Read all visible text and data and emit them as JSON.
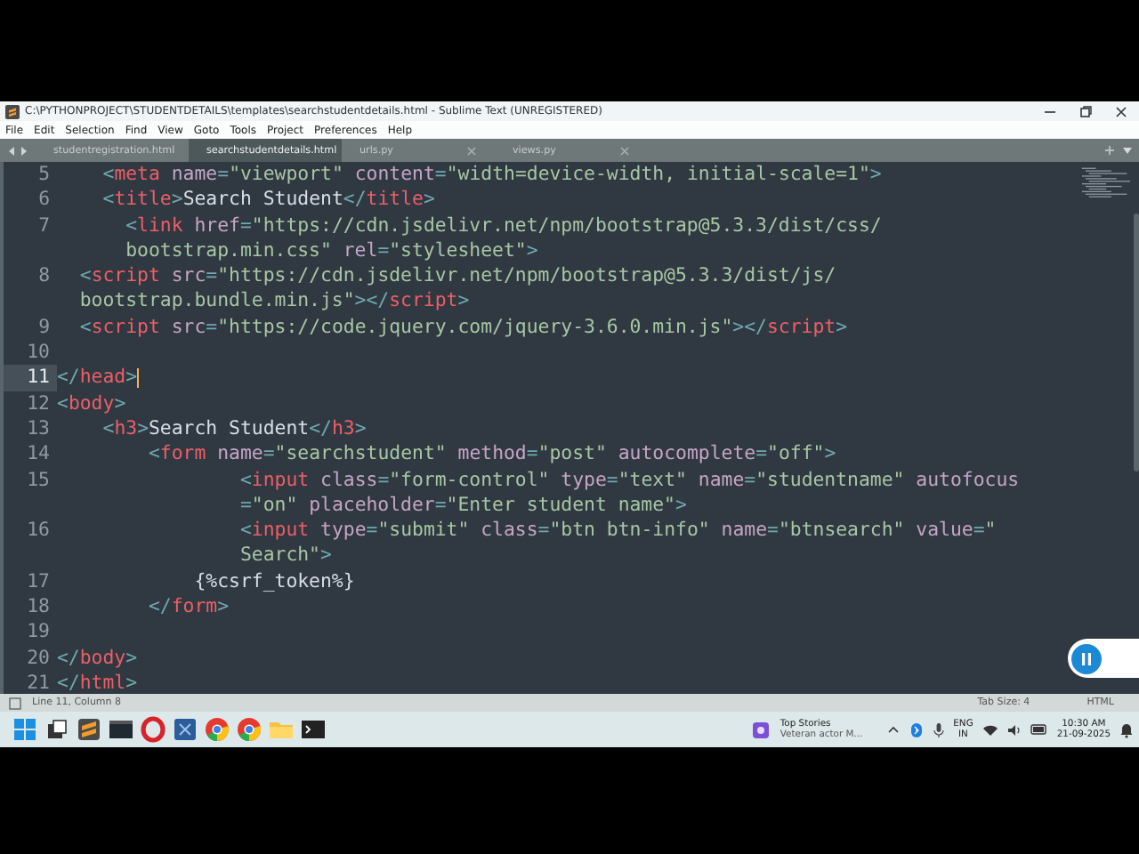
{
  "window": {
    "title": "C:\\PYTHONPROJECT\\STUDENTDETAILS\\templates\\searchstudentdetails.html - Sublime Text (UNREGISTERED)"
  },
  "menu": [
    "File",
    "Edit",
    "Selection",
    "Find",
    "View",
    "Goto",
    "Tools",
    "Project",
    "Preferences",
    "Help"
  ],
  "tabs": [
    {
      "label": "studentregistration.html",
      "selected": false
    },
    {
      "label": "searchstudentdetails.html",
      "selected": true
    },
    {
      "label": "urls.py",
      "selected": false
    },
    {
      "label": "views.py",
      "selected": false
    }
  ],
  "editor": {
    "lines": [
      {
        "number": "5",
        "current": false,
        "rows": [
          {
            "segments": [
              {
                "kind": "punct",
                "text": "    <"
              },
              {
                "kind": "tag",
                "text": "meta"
              },
              {
                "kind": "attr",
                "text": " name"
              },
              {
                "kind": "punct",
                "text": "="
              },
              {
                "kind": "string",
                "text": "\"viewport\""
              },
              {
                "kind": "attr",
                "text": " content"
              },
              {
                "kind": "punct",
                "text": "="
              },
              {
                "kind": "string",
                "text": "\"width=device-width, initial-scale=1\""
              },
              {
                "kind": "punct",
                "text": ">"
              }
            ]
          }
        ]
      },
      {
        "number": "6",
        "current": false,
        "rows": [
          {
            "segments": [
              {
                "kind": "punct",
                "text": "    <"
              },
              {
                "kind": "tag",
                "text": "title"
              },
              {
                "kind": "punct",
                "text": ">"
              },
              {
                "kind": "text",
                "text": "Search Student"
              },
              {
                "kind": "punct",
                "text": "</"
              },
              {
                "kind": "tag",
                "text": "title"
              },
              {
                "kind": "punct",
                "text": ">"
              }
            ]
          }
        ]
      },
      {
        "number": "7",
        "current": false,
        "rows": [
          {
            "segments": [
              {
                "kind": "punct",
                "text": "      <"
              },
              {
                "kind": "tag",
                "text": "link"
              },
              {
                "kind": "attr",
                "text": " href"
              },
              {
                "kind": "punct",
                "text": "="
              },
              {
                "kind": "string",
                "text": "\"https://cdn.jsdelivr.net/npm/bootstrap@5.3.3/dist/css/"
              }
            ]
          },
          {
            "segments": [
              {
                "kind": "string",
                "text": "      bootstrap.min.css\""
              },
              {
                "kind": "attr",
                "text": " rel"
              },
              {
                "kind": "punct",
                "text": "="
              },
              {
                "kind": "string",
                "text": "\"stylesheet\""
              },
              {
                "kind": "punct",
                "text": ">"
              }
            ]
          }
        ]
      },
      {
        "number": "8",
        "current": false,
        "rows": [
          {
            "segments": [
              {
                "kind": "punct",
                "text": "  <"
              },
              {
                "kind": "tag",
                "text": "script"
              },
              {
                "kind": "attr",
                "text": " src"
              },
              {
                "kind": "punct",
                "text": "="
              },
              {
                "kind": "string",
                "text": "\"https://cdn.jsdelivr.net/npm/bootstrap@5.3.3/dist/js/"
              }
            ]
          },
          {
            "segments": [
              {
                "kind": "string",
                "text": "  bootstrap.bundle.min.js\""
              },
              {
                "kind": "punct",
                "text": "></"
              },
              {
                "kind": "tag",
                "text": "script"
              },
              {
                "kind": "punct",
                "text": ">"
              }
            ]
          }
        ]
      },
      {
        "number": "9",
        "current": false,
        "rows": [
          {
            "segments": [
              {
                "kind": "punct",
                "text": "  <"
              },
              {
                "kind": "tag",
                "text": "script"
              },
              {
                "kind": "attr",
                "text": " src"
              },
              {
                "kind": "punct",
                "text": "="
              },
              {
                "kind": "string",
                "text": "\"https://code.jquery.com/jquery-3.6.0.min.js\""
              },
              {
                "kind": "punct",
                "text": "></"
              },
              {
                "kind": "tag",
                "text": "script"
              },
              {
                "kind": "punct",
                "text": ">"
              }
            ]
          }
        ]
      },
      {
        "number": "10",
        "current": false
      },
      {
        "number": "11",
        "current": true,
        "rows": [
          {
            "segments": [
              {
                "kind": "punct",
                "text": "</"
              },
              {
                "kind": "tag",
                "text": "head"
              },
              {
                "kind": "punct",
                "text": ">"
              }
            ]
          }
        ]
      },
      {
        "number": "12",
        "current": false,
        "rows": [
          {
            "segments": [
              {
                "kind": "punct",
                "text": "<"
              },
              {
                "kind": "tag",
                "text": "body"
              },
              {
                "kind": "punct",
                "text": ">"
              }
            ]
          }
        ]
      },
      {
        "number": "13",
        "current": false,
        "rows": [
          {
            "segments": [
              {
                "kind": "punct",
                "text": "    <"
              },
              {
                "kind": "tag",
                "text": "h3"
              },
              {
                "kind": "punct",
                "text": ">"
              },
              {
                "kind": "text",
                "text": "Search Student"
              },
              {
                "kind": "punct",
                "text": "</"
              },
              {
                "kind": "tag",
                "text": "h3"
              },
              {
                "kind": "punct",
                "text": ">"
              }
            ]
          }
        ]
      },
      {
        "number": "14",
        "current": false,
        "rows": [
          {
            "segments": [
              {
                "kind": "punct",
                "text": "        <"
              },
              {
                "kind": "tag",
                "text": "form"
              },
              {
                "kind": "attr",
                "text": " name"
              },
              {
                "kind": "punct",
                "text": "="
              },
              {
                "kind": "string",
                "text": "\"searchstudent\""
              },
              {
                "kind": "attr",
                "text": " method"
              },
              {
                "kind": "punct",
                "text": "="
              },
              {
                "kind": "string",
                "text": "\"post\""
              },
              {
                "kind": "attr",
                "text": " autocomplete"
              },
              {
                "kind": "punct",
                "text": "="
              },
              {
                "kind": "string",
                "text": "\"off\""
              },
              {
                "kind": "punct",
                "text": ">"
              }
            ]
          }
        ]
      },
      {
        "number": "15",
        "current": false,
        "rows": [
          {
            "segments": [
              {
                "kind": "punct",
                "text": "                <"
              },
              {
                "kind": "tag",
                "text": "input"
              },
              {
                "kind": "attr",
                "text": " class"
              },
              {
                "kind": "punct",
                "text": "="
              },
              {
                "kind": "string",
                "text": "\"form-control\""
              },
              {
                "kind": "attr",
                "text": " type"
              },
              {
                "kind": "punct",
                "text": "="
              },
              {
                "kind": "string",
                "text": "\"text\""
              },
              {
                "kind": "attr",
                "text": " name"
              },
              {
                "kind": "punct",
                "text": "="
              },
              {
                "kind": "string",
                "text": "\"studentname\""
              },
              {
                "kind": "attr",
                "text": " autofocus"
              }
            ]
          },
          {
            "segments": [
              {
                "kind": "punct",
                "text": "                ="
              },
              {
                "kind": "string",
                "text": "\"on\""
              },
              {
                "kind": "attr",
                "text": " placeholder"
              },
              {
                "kind": "punct",
                "text": "="
              },
              {
                "kind": "string",
                "text": "\"Enter student name\""
              },
              {
                "kind": "punct",
                "text": ">"
              }
            ]
          }
        ]
      },
      {
        "number": "16",
        "current": false,
        "rows": [
          {
            "segments": [
              {
                "kind": "punct",
                "text": "                <"
              },
              {
                "kind": "tag",
                "text": "input"
              },
              {
                "kind": "attr",
                "text": " type"
              },
              {
                "kind": "punct",
                "text": "="
              },
              {
                "kind": "string",
                "text": "\"submit\""
              },
              {
                "kind": "attr",
                "text": " class"
              },
              {
                "kind": "punct",
                "text": "="
              },
              {
                "kind": "string",
                "text": "\"btn btn-info\""
              },
              {
                "kind": "attr",
                "text": " name"
              },
              {
                "kind": "punct",
                "text": "="
              },
              {
                "kind": "string",
                "text": "\"btnsearch\""
              },
              {
                "kind": "attr",
                "text": " value"
              },
              {
                "kind": "punct",
                "text": "="
              },
              {
                "kind": "string",
                "text": "\""
              }
            ]
          },
          {
            "segments": [
              {
                "kind": "string",
                "text": "                Search\""
              },
              {
                "kind": "punct",
                "text": ">"
              }
            ]
          }
        ]
      },
      {
        "number": "17",
        "current": false,
        "rows": [
          {
            "segments": [
              {
                "kind": "text",
                "text": "            {%csrf_token%}"
              }
            ]
          }
        ]
      },
      {
        "number": "18",
        "current": false,
        "rows": [
          {
            "segments": [
              {
                "kind": "punct",
                "text": "        </"
              },
              {
                "kind": "tag",
                "text": "form"
              },
              {
                "kind": "punct",
                "text": ">"
              }
            ]
          }
        ]
      },
      {
        "number": "19",
        "current": false
      },
      {
        "number": "20",
        "current": false,
        "rows": [
          {
            "segments": [
              {
                "kind": "punct",
                "text": "</"
              },
              {
                "kind": "tag",
                "text": "body"
              },
              {
                "kind": "punct",
                "text": ">"
              }
            ]
          }
        ]
      },
      {
        "number": "21",
        "current": false,
        "rows": [
          {
            "segments": [
              {
                "kind": "punct",
                "text": "</"
              },
              {
                "kind": "tag",
                "text": "html"
              },
              {
                "kind": "punct",
                "text": ">"
              }
            ]
          }
        ]
      }
    ]
  },
  "status_bar": {
    "position": "Line 11, Column 8",
    "tab_size": "Tab Size: 4",
    "syntax": "HTML"
  },
  "taskbar": {
    "news_title": "Top Stories",
    "news_text": "Veteran actor M...",
    "language": "ENG",
    "region": "IN",
    "time": "10:30 AM",
    "date": "21-09-2025"
  }
}
